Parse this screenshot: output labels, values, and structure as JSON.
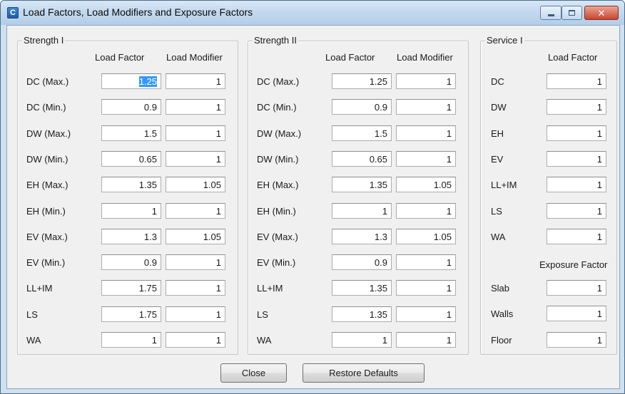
{
  "window": {
    "title": "Load Factors, Load Modifiers and Exposure Factors",
    "app_icon": "app-c-icon"
  },
  "strength1": {
    "title": "Strength I",
    "headers": {
      "load_factor": "Load Factor",
      "load_modifier": "Load Modifier"
    },
    "rows": [
      {
        "label": "DC (Max.)",
        "load_factor": "1.25",
        "load_modifier": "1"
      },
      {
        "label": "DC (Min.)",
        "load_factor": "0.9",
        "load_modifier": "1"
      },
      {
        "label": "DW (Max.)",
        "load_factor": "1.5",
        "load_modifier": "1"
      },
      {
        "label": "DW (Min.)",
        "load_factor": "0.65",
        "load_modifier": "1"
      },
      {
        "label": "EH (Max.)",
        "load_factor": "1.35",
        "load_modifier": "1.05"
      },
      {
        "label": "EH (Min.)",
        "load_factor": "1",
        "load_modifier": "1"
      },
      {
        "label": "EV (Max.)",
        "load_factor": "1.3",
        "load_modifier": "1.05"
      },
      {
        "label": "EV (Min.)",
        "load_factor": "0.9",
        "load_modifier": "1"
      },
      {
        "label": "LL+IM",
        "load_factor": "1.75",
        "load_modifier": "1"
      },
      {
        "label": "LS",
        "load_factor": "1.75",
        "load_modifier": "1"
      },
      {
        "label": "WA",
        "load_factor": "1",
        "load_modifier": "1"
      }
    ]
  },
  "strength2": {
    "title": "Strength II",
    "headers": {
      "load_factor": "Load Factor",
      "load_modifier": "Load Modifier"
    },
    "rows": [
      {
        "label": "DC (Max.)",
        "load_factor": "1.25",
        "load_modifier": "1"
      },
      {
        "label": "DC (Min.)",
        "load_factor": "0.9",
        "load_modifier": "1"
      },
      {
        "label": "DW (Max.)",
        "load_factor": "1.5",
        "load_modifier": "1"
      },
      {
        "label": "DW (Min.)",
        "load_factor": "0.65",
        "load_modifier": "1"
      },
      {
        "label": "EH (Max.)",
        "load_factor": "1.35",
        "load_modifier": "1.05"
      },
      {
        "label": "EH (Min.)",
        "load_factor": "1",
        "load_modifier": "1"
      },
      {
        "label": "EV (Max.)",
        "load_factor": "1.3",
        "load_modifier": "1.05"
      },
      {
        "label": "EV (Min.)",
        "load_factor": "0.9",
        "load_modifier": "1"
      },
      {
        "label": "LL+IM",
        "load_factor": "1.35",
        "load_modifier": "1"
      },
      {
        "label": "LS",
        "load_factor": "1.35",
        "load_modifier": "1"
      },
      {
        "label": "WA",
        "load_factor": "1",
        "load_modifier": "1"
      }
    ]
  },
  "service1": {
    "title": "Service I",
    "load_factor_header": "Load Factor",
    "rows": [
      {
        "label": "DC",
        "load_factor": "1"
      },
      {
        "label": "DW",
        "load_factor": "1"
      },
      {
        "label": "EH",
        "load_factor": "1"
      },
      {
        "label": "EV",
        "load_factor": "1"
      },
      {
        "label": "LL+IM",
        "load_factor": "1"
      },
      {
        "label": "LS",
        "load_factor": "1"
      },
      {
        "label": "WA",
        "load_factor": "1"
      }
    ],
    "exposure_header": "Exposure Factor",
    "exposure_rows": [
      {
        "label": "Slab",
        "value": "1"
      },
      {
        "label": "Walls",
        "value": "1"
      },
      {
        "label": "Floor",
        "value": "1"
      }
    ]
  },
  "buttons": {
    "close": "Close",
    "restore": "Restore Defaults"
  }
}
